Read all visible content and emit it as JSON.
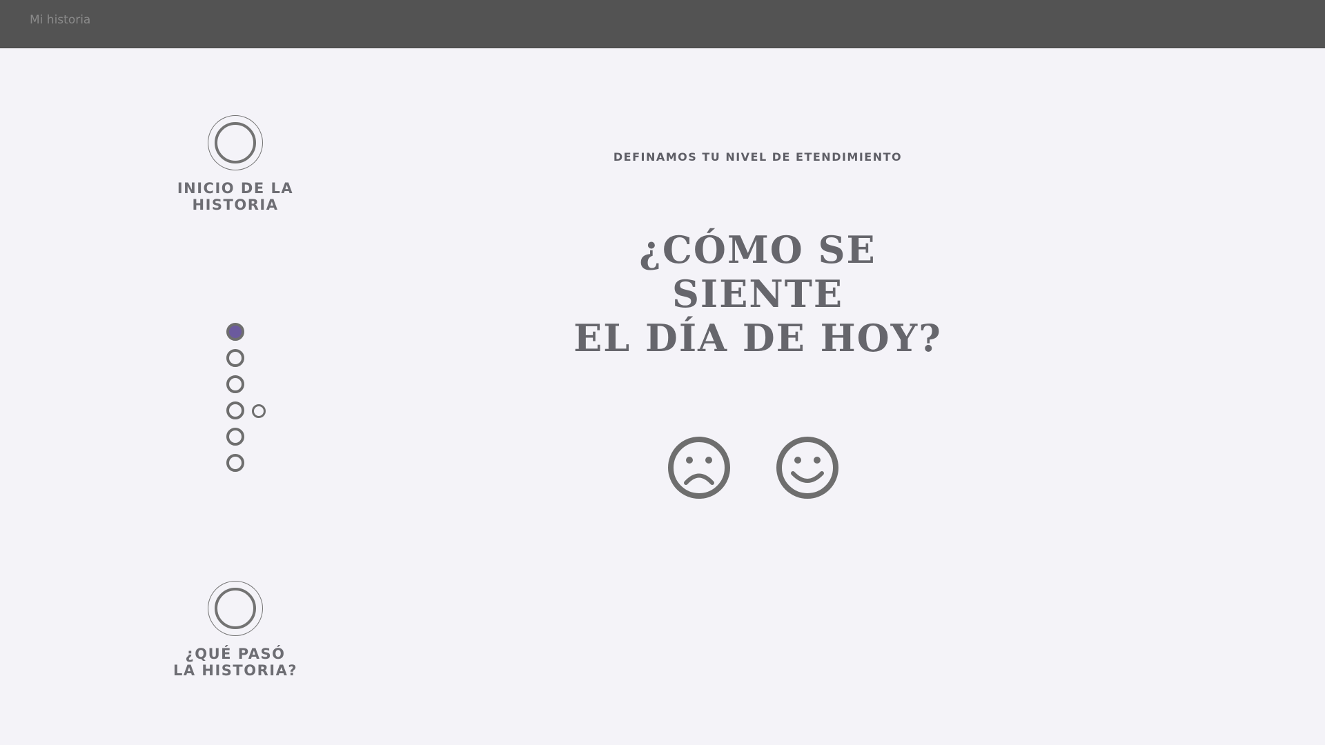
{
  "app": {
    "title": "Mi historia"
  },
  "milestones": {
    "start": {
      "label": "INICIO DE LA\nHISTORIA"
    },
    "end": {
      "label": "¿QUÉ PASÓ\nLA HISTORIA?"
    }
  },
  "steps": {
    "count": 6,
    "active_index": 0
  },
  "main": {
    "subtitle": "DEFINAMOS TU NIVEL DE ETENDIMIENTO",
    "question": "¿CÓMO SE SIENTE\nEL DÍA DE HOY?"
  },
  "mood_options": [
    {
      "icon": "sad-face-icon"
    },
    {
      "icon": "happy-face-icon"
    }
  ],
  "colors": {
    "topbar": "#535353",
    "background": "#f4f3f8",
    "active_step": "#6b5a9e",
    "text": "#66666c"
  }
}
